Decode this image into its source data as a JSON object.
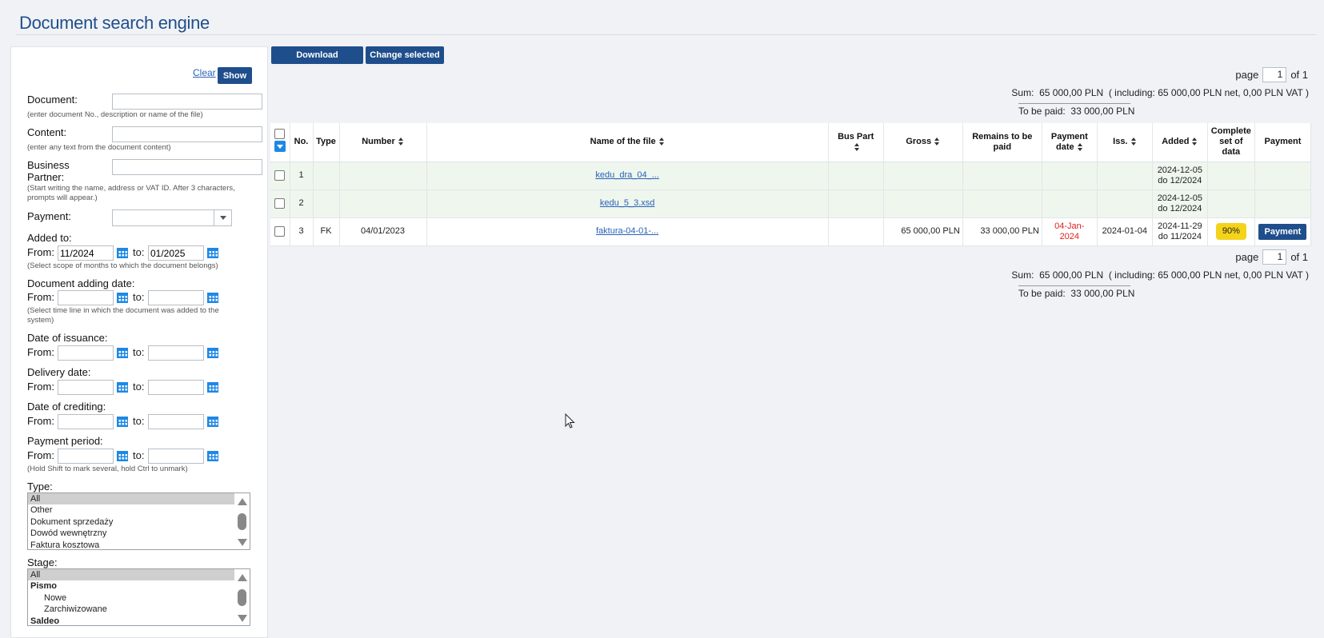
{
  "page": {
    "title": "Document search engine"
  },
  "filters": {
    "clear_label": "Clear",
    "show_label": "Show",
    "document": {
      "label": "Document:",
      "value": "",
      "hint": "(enter document No., description or name of the file)"
    },
    "content": {
      "label": "Content:",
      "value": "",
      "hint": "(enter any text from the document content)"
    },
    "business_partner": {
      "label": "Business Partner:",
      "value": "",
      "hint": "(Start writing the name, address or VAT ID. After 3 characters, prompts will appear.)"
    },
    "payment": {
      "label": "Payment:",
      "value": ""
    },
    "added_to": {
      "label": "Added to:",
      "from_label": "From:",
      "from": "11/2024",
      "to_label": "to:",
      "to": "01/2025",
      "hint": "(Select scope of months to which the document belongs)"
    },
    "adding_date": {
      "label": "Document adding date:",
      "from_label": "From:",
      "from": "",
      "to_label": "to:",
      "to": "",
      "hint": "(Select time line in which the document was added to the system)"
    },
    "issuance": {
      "label": "Date of issuance:",
      "from_label": "From:",
      "from": "",
      "to_label": "to:",
      "to": ""
    },
    "delivery": {
      "label": "Delivery date:",
      "from_label": "From:",
      "from": "",
      "to_label": "to:",
      "to": ""
    },
    "crediting": {
      "label": "Date of crediting:",
      "from_label": "From:",
      "from": "",
      "to_label": "to:",
      "to": ""
    },
    "period": {
      "label": "Payment period:",
      "from_label": "From:",
      "from": "",
      "to_label": "to:",
      "to": "",
      "hint": "(Hold Shift to mark several, hold Ctrl to unmark)"
    },
    "type": {
      "label": "Type:",
      "options": [
        "All",
        "Other",
        "Dokument sprzedaży",
        "Dowód wewnętrzny",
        "Faktura kosztowa"
      ],
      "selected": "All"
    },
    "stage": {
      "label": "Stage:",
      "options": [
        "All",
        "Pismo",
        "Nowe",
        "Zarchiwizowane",
        "Saldeo"
      ],
      "selected": "All"
    }
  },
  "toolbar": {
    "download_label": "Download",
    "change_selected_label": "Change selected"
  },
  "pager": {
    "page_label": "page",
    "page": "1",
    "of_label": "of 1"
  },
  "summary": {
    "sum_label": "Sum:",
    "sum_value": "65 000,00 PLN",
    "sum_detail": "( including: 65 000,00 PLN net, 0,00 PLN VAT )",
    "to_be_paid_label": "To be paid:",
    "to_be_paid_value": "33 000,00 PLN"
  },
  "table": {
    "headers": {
      "no": "No.",
      "type": "Type",
      "number": "Number",
      "file": "Name of the file",
      "bus_part": "Bus Part",
      "gross": "Gross",
      "remains": "Remains to be paid",
      "payment_date": "Payment date",
      "iss": "Iss.",
      "added": "Added",
      "complete": "Complete set of data",
      "payment": "Payment"
    },
    "rows": [
      {
        "no": "1",
        "type": "",
        "number": "",
        "file": "kedu_dra_04_...",
        "bus_part": "",
        "gross": "",
        "remains": "",
        "payment_date": "",
        "iss": "",
        "added_1": "2024-12-05",
        "added_2": "do 12/2024",
        "complete": "",
        "payment": ""
      },
      {
        "no": "2",
        "type": "",
        "number": "",
        "file": "kedu_5_3.xsd",
        "bus_part": "",
        "gross": "",
        "remains": "",
        "payment_date": "",
        "iss": "",
        "added_1": "2024-12-05",
        "added_2": "do 12/2024",
        "complete": "",
        "payment": ""
      },
      {
        "no": "3",
        "type": "FK",
        "number": "04/01/2023",
        "file": "faktura-04-01-...",
        "bus_part": "",
        "gross": "65 000,00 PLN",
        "remains": "33 000,00 PLN",
        "payment_date_1": "04-Jan-",
        "payment_date_2": "2024",
        "iss": "2024-01-04",
        "added_1": "2024-11-29",
        "added_2": "do 11/2024",
        "complete": "90%",
        "payment": "Payment"
      }
    ]
  },
  "colors": {
    "primary": "#1f4e8c",
    "link": "#2a62b8",
    "overdue": "#e02020",
    "badge": "#f5d31a",
    "row_alt": "#eef6ee"
  }
}
